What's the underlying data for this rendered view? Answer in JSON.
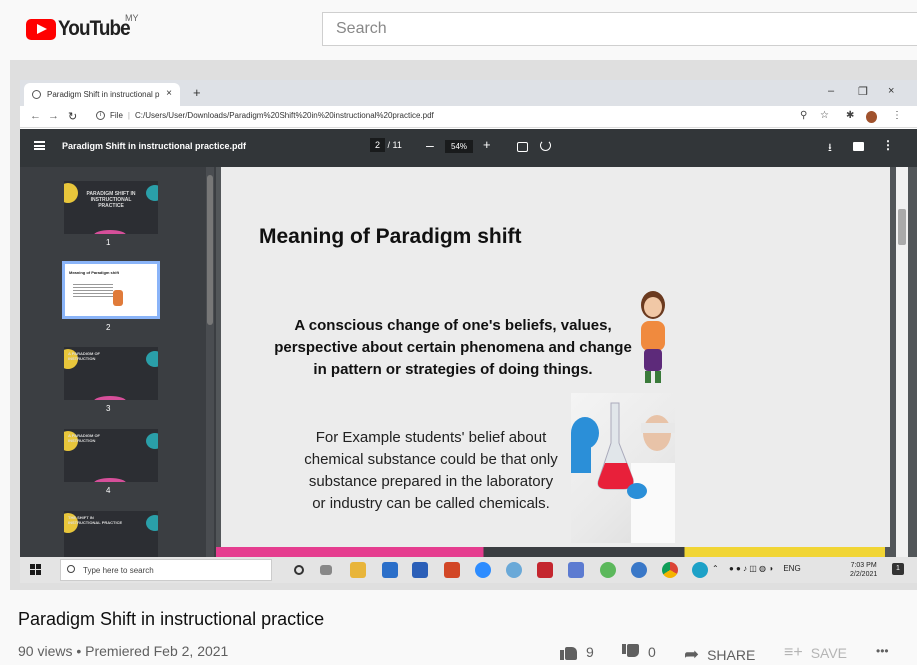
{
  "youtube": {
    "logo_text": "YouTube",
    "country": "MY",
    "search_placeholder": "Search"
  },
  "chrome": {
    "tab_title": "Paradigm Shift in instructional p",
    "tab_close": "×",
    "new_tab": "+",
    "window_min": "–",
    "window_max": "❐",
    "window_close": "×",
    "url_scheme": "File",
    "url": "C:/Users/User/Downloads/Paradigm%20Shift%20in%20instructional%20practice.pdf"
  },
  "pdf": {
    "filename": "Paradigm Shift in instructional practice.pdf",
    "page_current": "2",
    "page_total": "/ 11",
    "zoom": "54%",
    "thumbnails": [
      {
        "number": "1",
        "title": "PARADIGM SHIFT IN INSTRUCTIONAL PRACTICE"
      },
      {
        "number": "2",
        "title": "Meaning of Paradigm shift"
      },
      {
        "number": "3",
        "title": "A PARADIGM OF INSTRUCTION"
      },
      {
        "number": "4",
        "title": "A PARADIGM OF INSTRUCTION"
      },
      {
        "number": "",
        "title": "THE SHIFT IN INSTRUCTIONAL PRACTICE"
      }
    ],
    "slide": {
      "heading": "Meaning of Paradigm shift",
      "definition": "A conscious change of one's beliefs, values, perspective about certain phenomena and change in pattern or strategies of doing things.",
      "example": "For Example students' belief about chemical substance could be that only substance prepared in the laboratory or industry can be called chemicals."
    }
  },
  "taskbar": {
    "search_placeholder": "Type here to search",
    "language": "ENG",
    "time": "7:03 PM",
    "date": "2/2/2021",
    "notification_count": "1"
  },
  "video": {
    "title": "Paradigm Shift in instructional practice",
    "meta": "90 views • Premiered Feb 2, 2021",
    "likes": "9",
    "dislikes": "0",
    "share_label": "SHARE",
    "save_label": "SAVE",
    "more_label": "•••"
  },
  "colors": {
    "youtube_red": "#ff0000",
    "pdf_toolbar": "#323639",
    "sidebar": "#3b3e42",
    "active_thumb_border": "#8ab4f8"
  }
}
